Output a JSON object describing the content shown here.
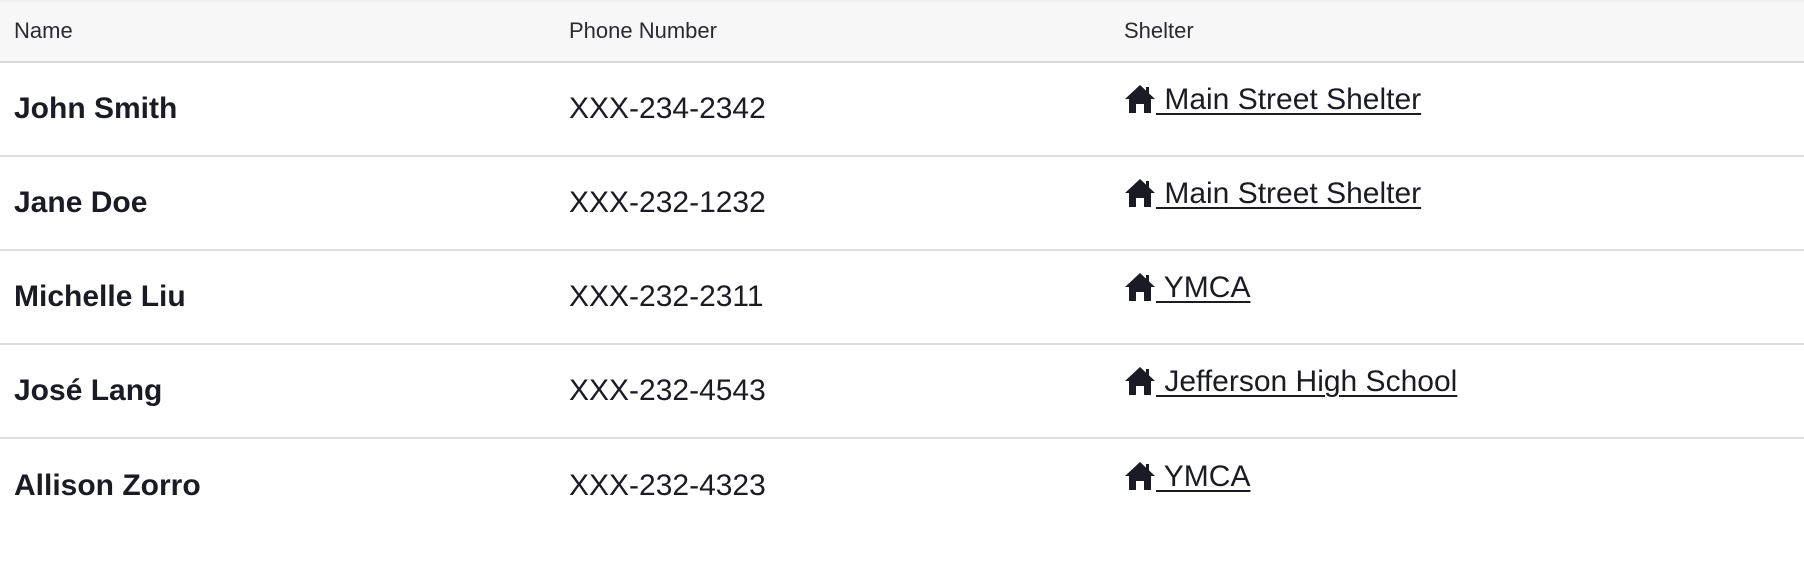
{
  "table": {
    "headers": {
      "name": "Name",
      "phone": "Phone Number",
      "shelter": "Shelter"
    },
    "rows": [
      {
        "name": "John Smith",
        "phone": "XXX-234-2342",
        "shelter": " Main Street Shelter"
      },
      {
        "name": "Jane Doe",
        "phone": "XXX-232-1232",
        "shelter": " Main Street Shelter"
      },
      {
        "name": "Michelle Liu",
        "phone": "XXX-232-2311",
        "shelter": " YMCA"
      },
      {
        "name": "José Lang",
        "phone": "XXX-232-4543",
        "shelter": " Jefferson High School"
      },
      {
        "name": "Allison Zorro",
        "phone": "XXX-232-4323",
        "shelter": " YMCA"
      }
    ],
    "shelter_icon": "home-icon"
  },
  "colors": {
    "text": "#1a1b25",
    "header_bg": "#f7f7f7",
    "row_divider": "#dedede"
  }
}
